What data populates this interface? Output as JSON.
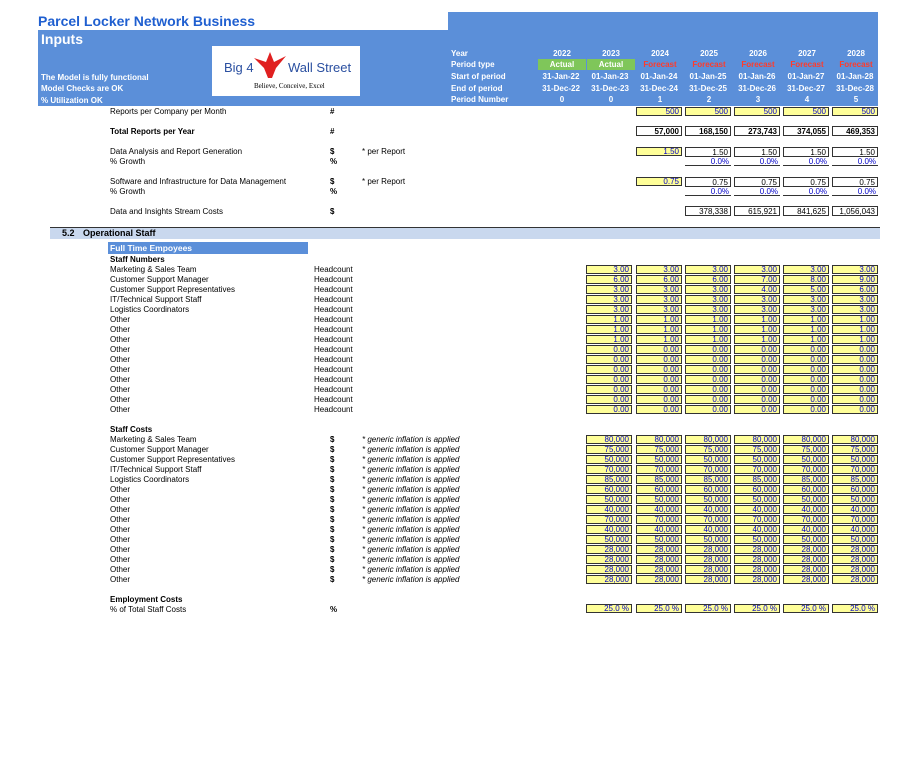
{
  "header": {
    "title": "Parcel Locker Network Business",
    "subtitle": "Inputs",
    "status": [
      "The Model is fully functional",
      "Model Checks are OK",
      "% Utilization OK"
    ]
  },
  "logo": {
    "left_text": "Big 4",
    "right_text": "Wall Street",
    "tagline": "Believe, Conceive, Excel"
  },
  "timeline": {
    "labels": [
      "Year",
      "Period type",
      "Start of period",
      "End of period",
      "Period Number"
    ],
    "columns": [
      {
        "year": "2022",
        "type": "Actual",
        "start": "31-Jan-22",
        "end": "31-Dec-22",
        "num": "0"
      },
      {
        "year": "2023",
        "type": "Actual",
        "start": "01-Jan-23",
        "end": "31-Dec-23",
        "num": "0"
      },
      {
        "year": "2024",
        "type": "Forecast",
        "start": "01-Jan-24",
        "end": "31-Dec-24",
        "num": "1"
      },
      {
        "year": "2025",
        "type": "Forecast",
        "start": "01-Jan-25",
        "end": "31-Dec-25",
        "num": "2"
      },
      {
        "year": "2026",
        "type": "Forecast",
        "start": "01-Jan-26",
        "end": "31-Dec-26",
        "num": "3"
      },
      {
        "year": "2027",
        "type": "Forecast",
        "start": "01-Jan-27",
        "end": "31-Dec-27",
        "num": "4"
      },
      {
        "year": "2028",
        "type": "Forecast",
        "start": "01-Jan-28",
        "end": "31-Dec-28",
        "num": "5"
      }
    ]
  },
  "data_stream": {
    "reports_per_month": {
      "label": "Reports per Company per Month",
      "unit": "#",
      "values": [
        "500",
        "500",
        "500",
        "500",
        "500"
      ]
    },
    "total_reports": {
      "label": "Total Reports per Year",
      "unit": "#",
      "values": [
        "57,000",
        "168,150",
        "273,743",
        "374,055",
        "469,353"
      ]
    },
    "analysis": {
      "label": "Data Analysis and Report Generation",
      "unit": "$",
      "note": "* per Report",
      "values": [
        "1.50",
        "1.50",
        "1.50",
        "1.50",
        "1.50"
      ]
    },
    "analysis_growth": {
      "label": "% Growth",
      "unit": "%",
      "values": [
        "0.0%",
        "0.0%",
        "0.0%",
        "0.0%"
      ]
    },
    "software": {
      "label": "Software and Infrastructure for Data Management",
      "unit": "$",
      "note": "* per Report",
      "values": [
        "0.75",
        "0.75",
        "0.75",
        "0.75",
        "0.75"
      ]
    },
    "software_growth": {
      "label": "% Growth",
      "unit": "%",
      "values": [
        "0.0%",
        "0.0%",
        "0.0%",
        "0.0%"
      ]
    },
    "costs": {
      "label": "Data and Insights Stream Costs",
      "unit": "$",
      "values": [
        "378,338",
        "615,921",
        "841,625",
        "1,056,043"
      ]
    }
  },
  "section": {
    "number": "5.2",
    "title": "Operational Staff"
  },
  "subheader": "Full Time Empoyees",
  "staff_numbers": {
    "heading": "Staff Numbers",
    "unit": "Headcount",
    "rows": [
      {
        "label": "Marketing & Sales Team",
        "values": [
          "3.00",
          "3.00",
          "3.00",
          "3.00",
          "3.00",
          "3.00"
        ]
      },
      {
        "label": "Customer Support Manager",
        "values": [
          "6.00",
          "6.00",
          "6.00",
          "7.00",
          "8.00",
          "9.00"
        ]
      },
      {
        "label": "Customer Support Representatives",
        "values": [
          "3.00",
          "3.00",
          "3.00",
          "4.00",
          "5.00",
          "6.00"
        ]
      },
      {
        "label": "IT/Technical Support Staff",
        "values": [
          "3.00",
          "3.00",
          "3.00",
          "3.00",
          "3.00",
          "3.00"
        ]
      },
      {
        "label": "Logistics Coordinators",
        "values": [
          "3.00",
          "3.00",
          "3.00",
          "3.00",
          "3.00",
          "3.00"
        ]
      },
      {
        "label": "Other",
        "values": [
          "1.00",
          "1.00",
          "1.00",
          "1.00",
          "1.00",
          "1.00"
        ]
      },
      {
        "label": "Other",
        "values": [
          "1.00",
          "1.00",
          "1.00",
          "1.00",
          "1.00",
          "1.00"
        ]
      },
      {
        "label": "Other",
        "values": [
          "1.00",
          "1.00",
          "1.00",
          "1.00",
          "1.00",
          "1.00"
        ]
      },
      {
        "label": "Other",
        "values": [
          "0.00",
          "0.00",
          "0.00",
          "0.00",
          "0.00",
          "0.00"
        ]
      },
      {
        "label": "Other",
        "values": [
          "0.00",
          "0.00",
          "0.00",
          "0.00",
          "0.00",
          "0.00"
        ]
      },
      {
        "label": "Other",
        "values": [
          "0.00",
          "0.00",
          "0.00",
          "0.00",
          "0.00",
          "0.00"
        ]
      },
      {
        "label": "Other",
        "values": [
          "0.00",
          "0.00",
          "0.00",
          "0.00",
          "0.00",
          "0.00"
        ]
      },
      {
        "label": "Other",
        "values": [
          "0.00",
          "0.00",
          "0.00",
          "0.00",
          "0.00",
          "0.00"
        ]
      },
      {
        "label": "Other",
        "values": [
          "0.00",
          "0.00",
          "0.00",
          "0.00",
          "0.00",
          "0.00"
        ]
      },
      {
        "label": "Other",
        "values": [
          "0.00",
          "0.00",
          "0.00",
          "0.00",
          "0.00",
          "0.00"
        ]
      }
    ]
  },
  "staff_costs": {
    "heading": "Staff Costs",
    "unit": "$",
    "note": "* generic inflation is applied",
    "rows": [
      {
        "label": "Marketing & Sales Team",
        "values": [
          "80,000",
          "80,000",
          "80,000",
          "80,000",
          "80,000",
          "80,000"
        ]
      },
      {
        "label": "Customer Support Manager",
        "values": [
          "75,000",
          "75,000",
          "75,000",
          "75,000",
          "75,000",
          "75,000"
        ]
      },
      {
        "label": "Customer Support Representatives",
        "values": [
          "50,000",
          "50,000",
          "50,000",
          "50,000",
          "50,000",
          "50,000"
        ]
      },
      {
        "label": "IT/Technical Support Staff",
        "values": [
          "70,000",
          "70,000",
          "70,000",
          "70,000",
          "70,000",
          "70,000"
        ]
      },
      {
        "label": "Logistics Coordinators",
        "values": [
          "85,000",
          "85,000",
          "85,000",
          "85,000",
          "85,000",
          "85,000"
        ]
      },
      {
        "label": "Other",
        "values": [
          "60,000",
          "60,000",
          "60,000",
          "60,000",
          "60,000",
          "60,000"
        ]
      },
      {
        "label": "Other",
        "values": [
          "50,000",
          "50,000",
          "50,000",
          "50,000",
          "50,000",
          "50,000"
        ]
      },
      {
        "label": "Other",
        "values": [
          "40,000",
          "40,000",
          "40,000",
          "40,000",
          "40,000",
          "40,000"
        ]
      },
      {
        "label": "Other",
        "values": [
          "70,000",
          "70,000",
          "70,000",
          "70,000",
          "70,000",
          "70,000"
        ]
      },
      {
        "label": "Other",
        "values": [
          "40,000",
          "40,000",
          "40,000",
          "40,000",
          "40,000",
          "40,000"
        ]
      },
      {
        "label": "Other",
        "values": [
          "50,000",
          "50,000",
          "50,000",
          "50,000",
          "50,000",
          "50,000"
        ]
      },
      {
        "label": "Other",
        "values": [
          "28,000",
          "28,000",
          "28,000",
          "28,000",
          "28,000",
          "28,000"
        ]
      },
      {
        "label": "Other",
        "values": [
          "28,000",
          "28,000",
          "28,000",
          "28,000",
          "28,000",
          "28,000"
        ]
      },
      {
        "label": "Other",
        "values": [
          "28,000",
          "28,000",
          "28,000",
          "28,000",
          "28,000",
          "28,000"
        ]
      },
      {
        "label": "Other",
        "values": [
          "28,000",
          "28,000",
          "28,000",
          "28,000",
          "28,000",
          "28,000"
        ]
      }
    ]
  },
  "employment": {
    "heading": "Employment Costs",
    "label": "% of Total Staff Costs",
    "unit": "%",
    "values": [
      "25.0 %",
      "25.0 %",
      "25.0 %",
      "25.0 %",
      "25.0 %",
      "25.0 %"
    ]
  },
  "colors": {
    "header_blue": "#5b8fd9",
    "title_blue": "#1f5fd0",
    "actual_green": "#7fc65a",
    "forecast_red": "#ff3b2b",
    "input_yellow": "#ffff99",
    "input_text": "#0000c8"
  }
}
